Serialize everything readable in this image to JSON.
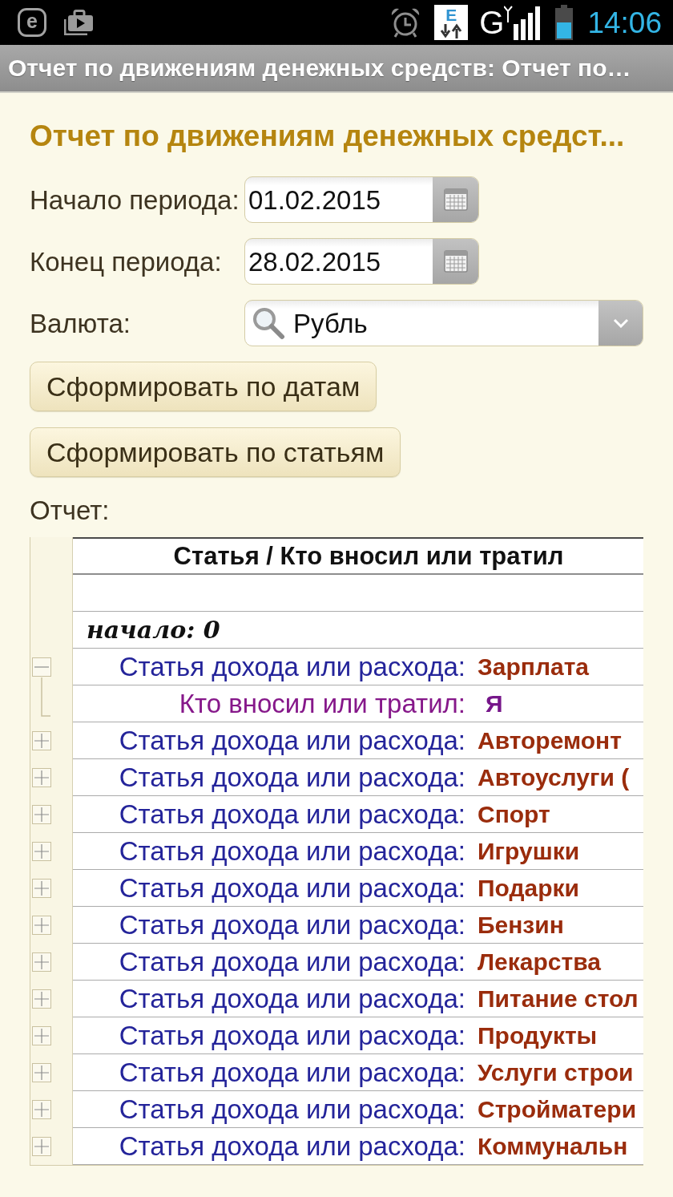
{
  "status_bar": {
    "app_badge": "e",
    "data_badge": "E",
    "network_type": "G",
    "time": "14:06"
  },
  "window": {
    "title": "Отчет по движениям денежных средств: Отчет по…"
  },
  "form": {
    "heading": "Отчет по движениям денежных средст...",
    "fields": [
      {
        "kind": "date",
        "label": "Начало периода:",
        "value": "01.02.2015"
      },
      {
        "kind": "date",
        "label": "Конец периода:",
        "value": "28.02.2015"
      },
      {
        "kind": "lookup",
        "label": "Валюта:",
        "value": "Рубль"
      }
    ],
    "buttons": [
      "Сформировать по датам",
      "Сформировать по статьям"
    ]
  },
  "report": {
    "label": "Отчет:",
    "columns": [
      "Статья / Кто вносил или тратил"
    ],
    "rows": [
      {
        "kind": "empty"
      },
      {
        "kind": "total",
        "text": "начало: 0"
      },
      {
        "kind": "item",
        "label": "Статья дохода или расхода:",
        "value": "Зарплата",
        "expanded": true,
        "children": [
          {
            "kind": "person",
            "label": "Кто вносил или тратил:",
            "value": "Я"
          }
        ]
      },
      {
        "kind": "item",
        "label": "Статья дохода или расхода:",
        "value": "Авторемонт",
        "expanded": false
      },
      {
        "kind": "item",
        "label": "Статья дохода или расхода:",
        "value": "Автоуслуги (",
        "expanded": false
      },
      {
        "kind": "item",
        "label": "Статья дохода или расхода:",
        "value": "Спорт",
        "expanded": false
      },
      {
        "kind": "item",
        "label": "Статья дохода или расхода:",
        "value": "Игрушки",
        "expanded": false
      },
      {
        "kind": "item",
        "label": "Статья дохода или расхода:",
        "value": "Подарки",
        "expanded": false
      },
      {
        "kind": "item",
        "label": "Статья дохода или расхода:",
        "value": "Бензин",
        "expanded": false
      },
      {
        "kind": "item",
        "label": "Статья дохода или расхода:",
        "value": "Лекарства",
        "expanded": false
      },
      {
        "kind": "item",
        "label": "Статья дохода или расхода:",
        "value": "Питание стол",
        "expanded": false
      },
      {
        "kind": "item",
        "label": "Статья дохода или расхода:",
        "value": "Продукты",
        "expanded": false
      },
      {
        "kind": "item",
        "label": "Статья дохода или расхода:",
        "value": "Услуги строи",
        "expanded": false
      },
      {
        "kind": "item",
        "label": "Статья дохода или расхода:",
        "value": "Стройматери",
        "expanded": false
      },
      {
        "kind": "item",
        "label": "Статья дохода или расхода:",
        "value": "Коммунальн",
        "expanded": false
      }
    ]
  }
}
